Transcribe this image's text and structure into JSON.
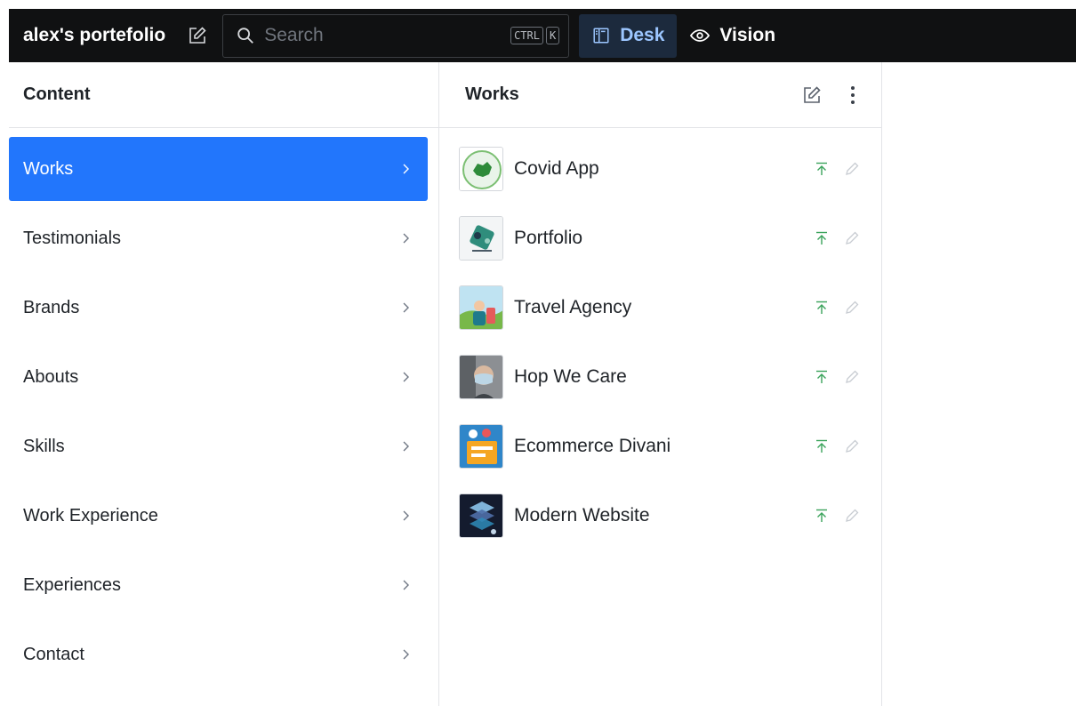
{
  "topbar": {
    "project_title": "alex's portefolio",
    "search_placeholder": "Search",
    "shortcut_keys": [
      "CTRL",
      "K"
    ],
    "tools": [
      {
        "label": "Desk",
        "icon": "desk-icon",
        "active": true
      },
      {
        "label": "Vision",
        "icon": "eye-icon",
        "active": false
      }
    ]
  },
  "content_pane": {
    "title": "Content",
    "items": [
      {
        "label": "Works",
        "selected": true
      },
      {
        "label": "Testimonials",
        "selected": false
      },
      {
        "label": "Brands",
        "selected": false
      },
      {
        "label": "Abouts",
        "selected": false
      },
      {
        "label": "Skills",
        "selected": false
      },
      {
        "label": "Work Experience",
        "selected": false
      },
      {
        "label": "Experiences",
        "selected": false
      },
      {
        "label": "Contact",
        "selected": false
      }
    ]
  },
  "works_pane": {
    "title": "Works",
    "items": [
      {
        "title": "Covid App",
        "status": "published"
      },
      {
        "title": "Portfolio",
        "status": "published"
      },
      {
        "title": "Travel Agency",
        "status": "published"
      },
      {
        "title": "Hop We Care",
        "status": "published"
      },
      {
        "title": "Ecommerce Divani",
        "status": "published"
      },
      {
        "title": "Modern Website",
        "status": "published"
      }
    ]
  },
  "colors": {
    "topbar_bg": "#101112",
    "accent": "#2276fc",
    "active_tool_text": "#9cc6ff",
    "published_green": "#3aa35b"
  }
}
